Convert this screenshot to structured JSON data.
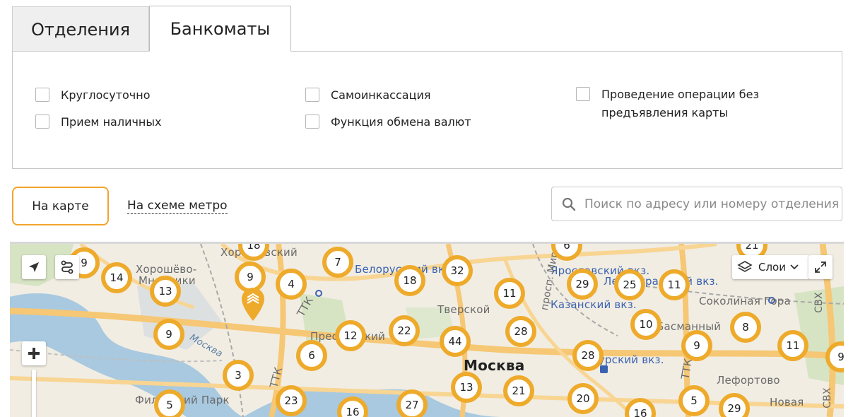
{
  "tabs": {
    "branches": "Отделения",
    "atms": "Банкоматы"
  },
  "filters": {
    "round_clock": "Круглосуточно",
    "cash_in": "Прием наличных",
    "self_collection": "Самоинкассация",
    "currency_exchange": "Функция обмена валют",
    "no_card_operation": "Проведение операции без предъявления карты"
  },
  "view": {
    "map_button": "На карте",
    "metro_link": "На схеме метро"
  },
  "search": {
    "placeholder": "Поиск по адресу или номеру отделения",
    "value": ""
  },
  "map": {
    "layers_label": "Слои",
    "labels": {
      "khoroshevsky": "Хорошевский",
      "khoroshevo": "Хорошёво-",
      "mnevniki": "Мневники",
      "belorussky": "Белорусский вкз.",
      "tverskoy": "Тверской",
      "presnensky": "Пресненский",
      "moskva": "Москва",
      "yaroslavsky": "Ярославский вкз.",
      "leningradsky": "Ленинградский вкз.",
      "kazansky": "Казанский вкз.",
      "sokolinaya": "Соколиная Гора",
      "lefortovo": "Лефортово",
      "fili": "Филёвский Парк",
      "ttk1": "ТТК",
      "ttk2": "ТТК",
      "ttk3": "ТТК",
      "river": "Москва",
      "prospekt": "просп. Мира",
      "svh1": "СВХ",
      "svh2": "СВХ",
      "kursky": "Курский вкз.",
      "basmanny": "Басманный",
      "novogireevo": "Новая"
    },
    "clusters": [
      {
        "n": "9"
      },
      {
        "n": "14"
      },
      {
        "n": "13"
      },
      {
        "n": "9"
      },
      {
        "n": "4"
      },
      {
        "n": "7"
      },
      {
        "n": "18"
      },
      {
        "n": "32"
      },
      {
        "n": "11"
      },
      {
        "n": "29"
      },
      {
        "n": "25"
      },
      {
        "n": "11"
      },
      {
        "n": "9"
      },
      {
        "n": "12"
      },
      {
        "n": "22"
      },
      {
        "n": "44"
      },
      {
        "n": "28"
      },
      {
        "n": "10"
      },
      {
        "n": "8"
      },
      {
        "n": "9"
      },
      {
        "n": "11"
      },
      {
        "n": "6"
      },
      {
        "n": "28"
      },
      {
        "n": "3"
      },
      {
        "n": "23"
      },
      {
        "n": "13"
      },
      {
        "n": "21"
      },
      {
        "n": "20"
      },
      {
        "n": "5"
      },
      {
        "n": "29"
      },
      {
        "n": "5"
      },
      {
        "n": "16"
      },
      {
        "n": "27"
      },
      {
        "n": "16"
      },
      {
        "n": "18"
      },
      {
        "n": "6"
      },
      {
        "n": "21"
      },
      {
        "n": "9"
      }
    ],
    "colors": {
      "cluster": "#eeaa2b",
      "accent": "#f2a42d"
    }
  }
}
